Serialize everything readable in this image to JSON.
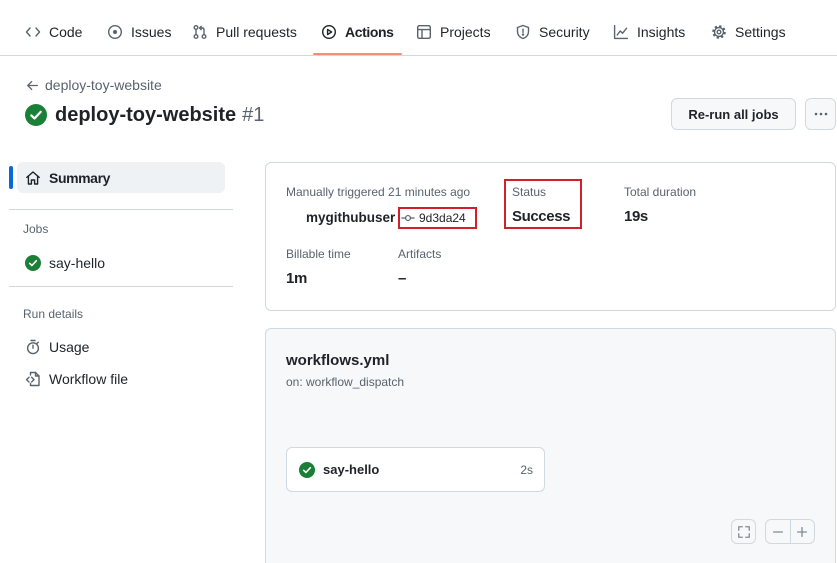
{
  "nav": {
    "items": [
      {
        "label": "Code",
        "icon": "code-icon"
      },
      {
        "label": "Issues",
        "icon": "issue-opened-icon"
      },
      {
        "label": "Pull requests",
        "icon": "git-pull-request-icon"
      },
      {
        "label": "Actions",
        "icon": "play-icon",
        "active": true
      },
      {
        "label": "Projects",
        "icon": "table-icon"
      },
      {
        "label": "Security",
        "icon": "shield-icon"
      },
      {
        "label": "Insights",
        "icon": "graph-icon"
      },
      {
        "label": "Settings",
        "icon": "gear-icon"
      }
    ]
  },
  "run": {
    "back_label": "deploy-toy-website",
    "back_icon": "arrow-left-icon",
    "status_icon": "check-circle-fill-icon",
    "title": "deploy-toy-website",
    "number": "#1",
    "rerun_button": "Re-run all jobs",
    "more_button_icon": "kebab-horizontal-icon"
  },
  "sidebar": {
    "summary": {
      "label": "Summary",
      "icon": "home-icon",
      "selected": true
    },
    "jobs_heading": "Jobs",
    "jobs": [
      {
        "label": "say-hello",
        "icon": "check-circle-fill-icon"
      }
    ],
    "run_details_heading": "Run details",
    "run_details": [
      {
        "label": "Usage",
        "icon": "stopwatch-icon"
      },
      {
        "label": "Workflow file",
        "icon": "file-code-icon"
      }
    ]
  },
  "summary_card": {
    "trigger_text": "Manually triggered 21 minutes ago",
    "actor": "mygithubuser",
    "commit_icon": "git-commit-icon",
    "commit_sha": "9d3da24",
    "status_label": "Status",
    "status_value": "Success",
    "duration_label": "Total duration",
    "duration_value": "19s",
    "billable_label": "Billable time",
    "billable_value": "1m",
    "artifacts_label": "Artifacts",
    "artifacts_value": "–"
  },
  "workflow_graph": {
    "file_name": "workflows.yml",
    "trigger": "on: workflow_dispatch",
    "jobs": [
      {
        "label": "say-hello",
        "duration": "2s",
        "icon": "check-circle-fill-icon"
      }
    ],
    "controls": {
      "fullscreen_icon": "screen-full-icon",
      "zoom_out_icon": "dash-icon",
      "zoom_in_icon": "plus-icon"
    }
  },
  "annotations": {
    "highlighted": [
      "commit_sha",
      "status"
    ]
  },
  "colors": {
    "accent": "#0969da",
    "active_tab_underline": "#fd8c73",
    "success": "#1a7f37",
    "annotation_red": "#d0202a",
    "border": "#d1d9e0",
    "muted_text": "#59636e",
    "graph_background": "#f6f8fa"
  }
}
